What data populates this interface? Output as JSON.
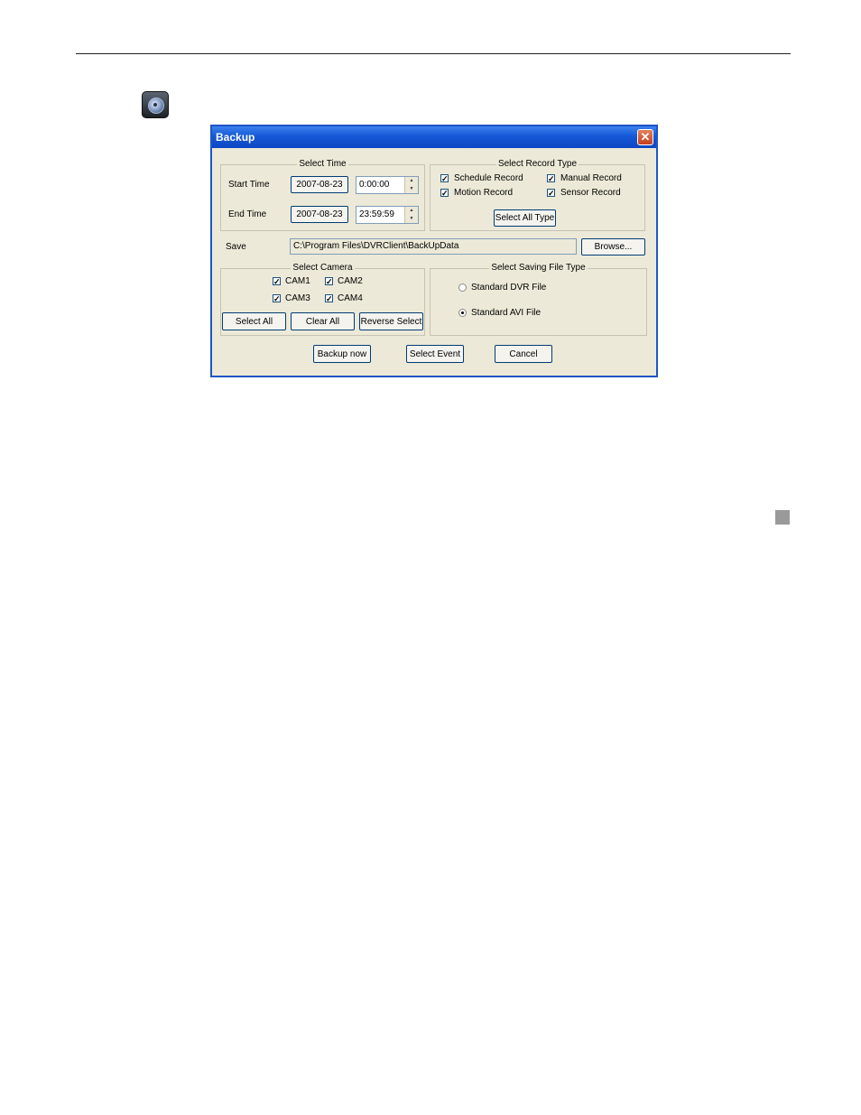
{
  "dialog": {
    "title": "Backup",
    "close_symbol": "✕"
  },
  "select_time": {
    "legend": "Select Time",
    "start_label": "Start Time",
    "start_date": "2007-08-23",
    "start_time": "0:00:00",
    "end_label": "End Time",
    "end_date": "2007-08-23",
    "end_time": "23:59:59"
  },
  "record_type": {
    "legend": "Select Record Type",
    "schedule": "Schedule Record",
    "manual": "Manual Record",
    "motion": "Motion Record",
    "sensor": "Sensor Record",
    "select_all": "Select All Type"
  },
  "save": {
    "label": "Save",
    "path": "C:\\Program Files\\DVRClient\\BackUpData",
    "browse": "Browse..."
  },
  "camera": {
    "legend": "Select Camera",
    "cams": [
      "CAM1",
      "CAM2",
      "CAM3",
      "CAM4"
    ],
    "select_all": "Select All",
    "clear_all": "Clear All",
    "reverse_select": "Reverse Select"
  },
  "file_type": {
    "legend": "Select Saving File Type",
    "dvr": "Standard DVR File",
    "avi": "Standard AVI File"
  },
  "actions": {
    "backup_now": "Backup now",
    "select_event": "Select Event",
    "cancel": "Cancel"
  }
}
